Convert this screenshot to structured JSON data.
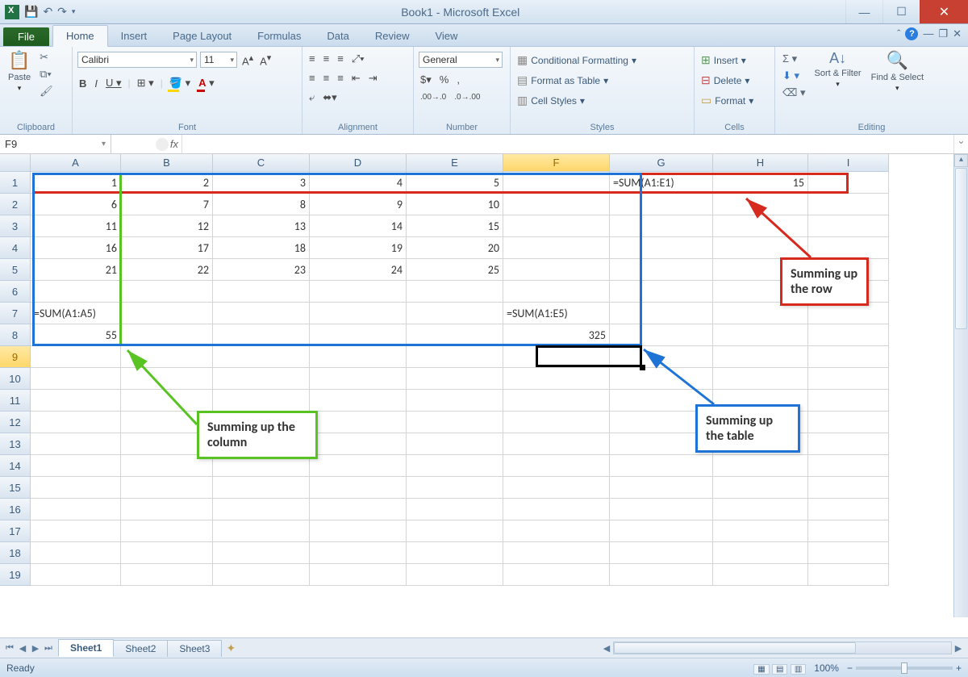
{
  "titlebar": {
    "title": "Book1 - Microsoft Excel"
  },
  "tabs": {
    "file": "File",
    "home": "Home",
    "insert": "Insert",
    "page_layout": "Page Layout",
    "formulas": "Formulas",
    "data": "Data",
    "review": "Review",
    "view": "View"
  },
  "ribbon": {
    "clipboard": {
      "paste": "Paste",
      "label": "Clipboard"
    },
    "font": {
      "name": "Calibri",
      "size": "11",
      "label": "Font"
    },
    "alignment": {
      "label": "Alignment"
    },
    "numfmt": {
      "label": "Number",
      "type": "General"
    },
    "styles": {
      "cond": "Conditional Formatting",
      "table": "Format as Table",
      "cellstyles": "Cell Styles",
      "label": "Styles"
    },
    "cells": {
      "insert": "Insert",
      "delete": "Delete",
      "format": "Format",
      "label": "Cells"
    },
    "editing": {
      "sort": "Sort & Filter",
      "find": "Find & Select",
      "label": "Editing"
    }
  },
  "namebox": "F9",
  "formula": "",
  "columns": [
    "A",
    "B",
    "C",
    "D",
    "E",
    "F",
    "G",
    "H",
    "I"
  ],
  "active_col": "F",
  "active_row": 9,
  "rows": 19,
  "cells": {
    "A1": {
      "v": "1",
      "t": "num"
    },
    "B1": {
      "v": "2",
      "t": "num"
    },
    "C1": {
      "v": "3",
      "t": "num"
    },
    "D1": {
      "v": "4",
      "t": "num"
    },
    "E1": {
      "v": "5",
      "t": "num"
    },
    "G1": {
      "v": "=SUM(A1:E1)",
      "t": "txt"
    },
    "H1": {
      "v": "15",
      "t": "num"
    },
    "A2": {
      "v": "6",
      "t": "num"
    },
    "B2": {
      "v": "7",
      "t": "num"
    },
    "C2": {
      "v": "8",
      "t": "num"
    },
    "D2": {
      "v": "9",
      "t": "num"
    },
    "E2": {
      "v": "10",
      "t": "num"
    },
    "A3": {
      "v": "11",
      "t": "num"
    },
    "B3": {
      "v": "12",
      "t": "num"
    },
    "C3": {
      "v": "13",
      "t": "num"
    },
    "D3": {
      "v": "14",
      "t": "num"
    },
    "E3": {
      "v": "15",
      "t": "num"
    },
    "A4": {
      "v": "16",
      "t": "num"
    },
    "B4": {
      "v": "17",
      "t": "num"
    },
    "C4": {
      "v": "18",
      "t": "num"
    },
    "D4": {
      "v": "19",
      "t": "num"
    },
    "E4": {
      "v": "20",
      "t": "num"
    },
    "A5": {
      "v": "21",
      "t": "num"
    },
    "B5": {
      "v": "22",
      "t": "num"
    },
    "C5": {
      "v": "23",
      "t": "num"
    },
    "D5": {
      "v": "24",
      "t": "num"
    },
    "E5": {
      "v": "25",
      "t": "num"
    },
    "A7": {
      "v": "=SUM(A1:A5)",
      "t": "txt"
    },
    "F7": {
      "v": "=SUM(A1:E5)",
      "t": "txt"
    },
    "A8": {
      "v": "55",
      "t": "num"
    },
    "F8": {
      "v": "325",
      "t": "num"
    }
  },
  "annotations": {
    "red_label": "Summing up the row",
    "green_label": "Summing up the column",
    "blue_label": "Summing up the table"
  },
  "sheets": {
    "s1": "Sheet1",
    "s2": "Sheet2",
    "s3": "Sheet3"
  },
  "status": {
    "ready": "Ready",
    "zoom": "100%"
  }
}
